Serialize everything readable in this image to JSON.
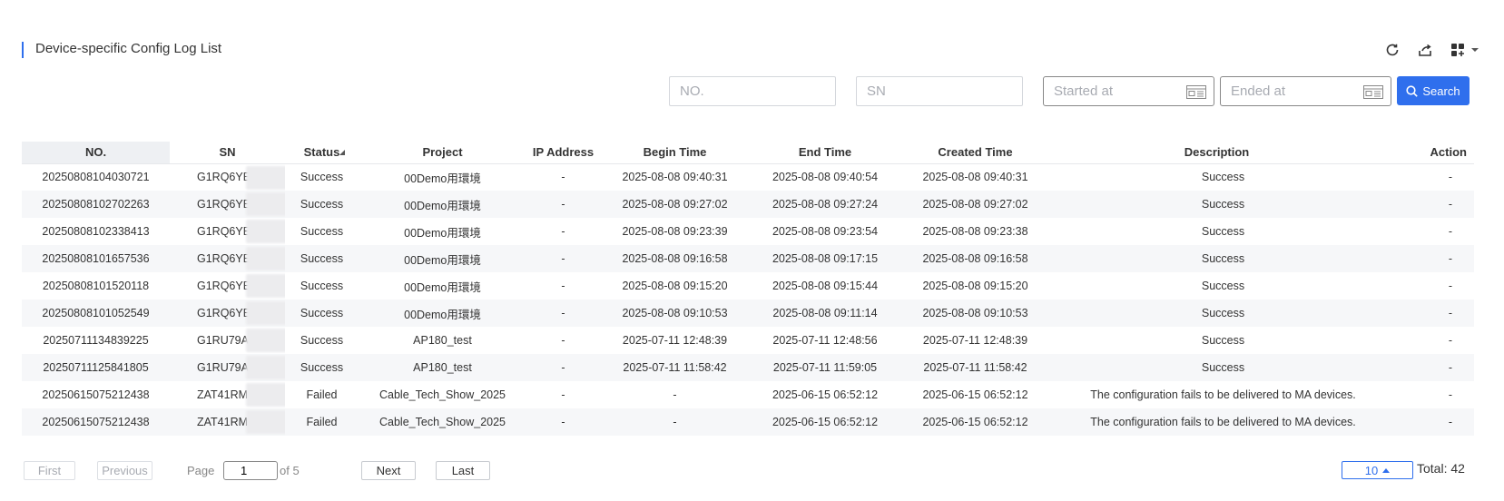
{
  "page_title": "Device-specific Config Log List",
  "toolbar": {
    "icons": [
      "refresh-icon",
      "export-icon",
      "grid-view-icon",
      "chevron-down-icon"
    ]
  },
  "filters": {
    "no_placeholder": "NO.",
    "sn_placeholder": "SN",
    "started_placeholder": "Started at",
    "ended_placeholder": "Ended at",
    "search_label": "Search"
  },
  "table": {
    "columns": [
      "NO.",
      "SN",
      "Status",
      "Project",
      "IP Address",
      "Begin Time",
      "End Time",
      "Created Time",
      "Description",
      "Action"
    ],
    "rows": [
      {
        "no": "20250808104030721",
        "sn": "G1RQ6YE",
        "status": "Success",
        "project": "00Demo用環境",
        "ip": "-",
        "begin": "2025-08-08 09:40:31",
        "end": "2025-08-08 09:40:54",
        "created": "2025-08-08 09:40:31",
        "desc": "Success",
        "action": "-"
      },
      {
        "no": "20250808102702263",
        "sn": "G1RQ6YE",
        "status": "Success",
        "project": "00Demo用環境",
        "ip": "-",
        "begin": "2025-08-08 09:27:02",
        "end": "2025-08-08 09:27:24",
        "created": "2025-08-08 09:27:02",
        "desc": "Success",
        "action": "-"
      },
      {
        "no": "20250808102338413",
        "sn": "G1RQ6YE",
        "status": "Success",
        "project": "00Demo用環境",
        "ip": "-",
        "begin": "2025-08-08 09:23:39",
        "end": "2025-08-08 09:23:54",
        "created": "2025-08-08 09:23:38",
        "desc": "Success",
        "action": "-"
      },
      {
        "no": "20250808101657536",
        "sn": "G1RQ6YE",
        "status": "Success",
        "project": "00Demo用環境",
        "ip": "-",
        "begin": "2025-08-08 09:16:58",
        "end": "2025-08-08 09:17:15",
        "created": "2025-08-08 09:16:58",
        "desc": "Success",
        "action": "-"
      },
      {
        "no": "20250808101520118",
        "sn": "G1RQ6YE",
        "status": "Success",
        "project": "00Demo用環境",
        "ip": "-",
        "begin": "2025-08-08 09:15:20",
        "end": "2025-08-08 09:15:44",
        "created": "2025-08-08 09:15:20",
        "desc": "Success",
        "action": "-"
      },
      {
        "no": "20250808101052549",
        "sn": "G1RQ6YE",
        "status": "Success",
        "project": "00Demo用環境",
        "ip": "-",
        "begin": "2025-08-08 09:10:53",
        "end": "2025-08-08 09:11:14",
        "created": "2025-08-08 09:10:53",
        "desc": "Success",
        "action": "-"
      },
      {
        "no": "20250711134839225",
        "sn": "G1RU79A",
        "status": "Success",
        "project": "AP180_test",
        "ip": "-",
        "begin": "2025-07-11 12:48:39",
        "end": "2025-07-11 12:48:56",
        "created": "2025-07-11 12:48:39",
        "desc": "Success",
        "action": "-"
      },
      {
        "no": "20250711125841805",
        "sn": "G1RU79A",
        "status": "Success",
        "project": "AP180_test",
        "ip": "-",
        "begin": "2025-07-11 11:58:42",
        "end": "2025-07-11 11:59:05",
        "created": "2025-07-11 11:58:42",
        "desc": "Success",
        "action": "-"
      },
      {
        "no": "20250615075212438",
        "sn": "ZAT41RM",
        "status": "Failed",
        "project": "Cable_Tech_Show_2025",
        "ip": "-",
        "begin": "-",
        "end": "2025-06-15 06:52:12",
        "created": "2025-06-15 06:52:12",
        "desc": "The configuration fails to be delivered to MA devices.",
        "action": "-"
      },
      {
        "no": "20250615075212438",
        "sn": "ZAT41RM",
        "status": "Failed",
        "project": "Cable_Tech_Show_2025",
        "ip": "-",
        "begin": "-",
        "end": "2025-06-15 06:52:12",
        "created": "2025-06-15 06:52:12",
        "desc": "The configuration fails to be delivered to MA devices.",
        "action": "-"
      }
    ]
  },
  "pager": {
    "first": "First",
    "previous": "Previous",
    "page_label": "Page",
    "current_page": "1",
    "of_label": "of 5",
    "next": "Next",
    "last": "Last",
    "page_size": "10",
    "total": "Total: 42"
  },
  "colors": {
    "accent": "#2f6fed",
    "row_alt": "#f6f7f9",
    "header_sorted": "#eef0f3"
  }
}
